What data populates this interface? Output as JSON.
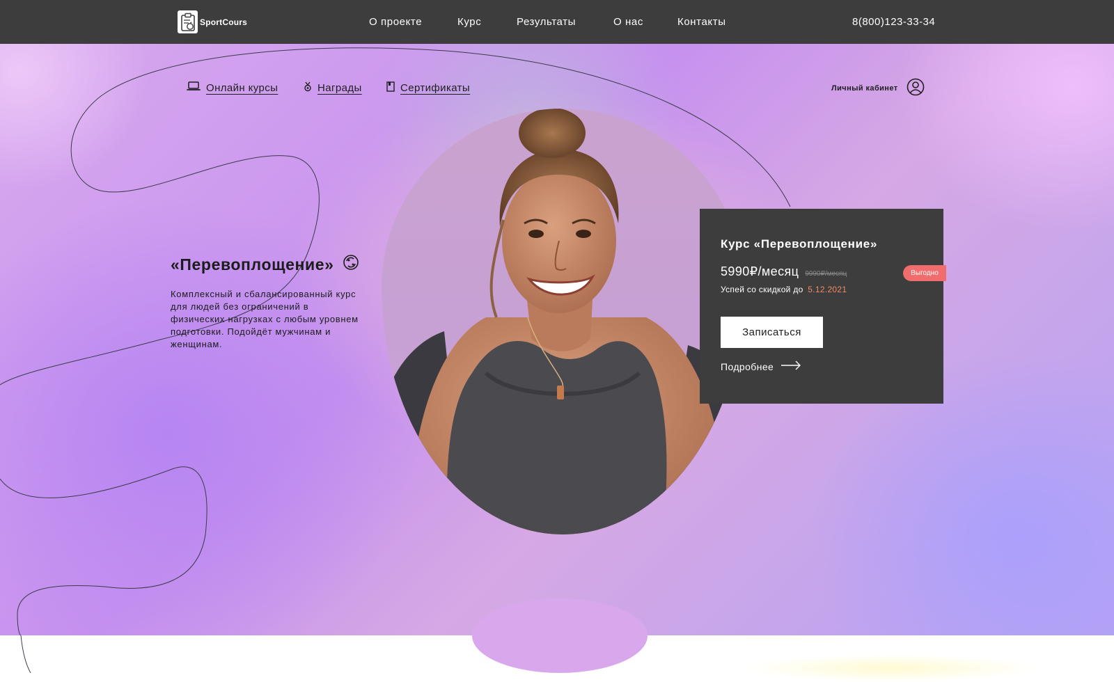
{
  "header": {
    "brand": "SportCours",
    "logo_icon": "clipboard-apple-icon",
    "nav": [
      {
        "label": "О проекте"
      },
      {
        "label": "Курс"
      },
      {
        "label": "Результаты"
      },
      {
        "label": "О нас"
      },
      {
        "label": "Контакты"
      }
    ],
    "phone": "8(800)123-33-34",
    "background_color": "#3d3d3d"
  },
  "subnav": {
    "items": [
      {
        "label": "Онлайн курсы",
        "icon": "laptop-icon"
      },
      {
        "label": "Награды",
        "icon": "medal-icon"
      },
      {
        "label": "Сертификаты",
        "icon": "certificate-icon"
      }
    ],
    "cabinet_label": "Личный кабинет",
    "cabinet_icon": "user-circle-icon"
  },
  "hero": {
    "title": "«Перевоплощение»",
    "title_icon": "recycle-icon",
    "description": "Комплексный и сбалансированный курс для людей без ограничений в физических нагрузках с любым уровнем подготовки. Подойдёт мужчинам и женщинам."
  },
  "card": {
    "title": "Курс «Перевоплощение»",
    "price": "5990₽/месяц",
    "old_price": "9990₽/месяц",
    "badge": "Выгодно",
    "discount_text": "Успей со скидкой до",
    "discount_date": "5.12.2021",
    "cta": "Записаться",
    "more": "Подробнее",
    "more_icon": "arrow-right-icon",
    "background_color": "#3d3d3d",
    "badge_color": "#f16c6c",
    "date_color": "#f08a66"
  }
}
